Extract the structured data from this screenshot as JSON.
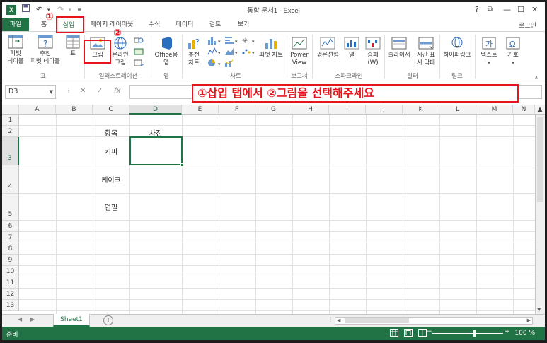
{
  "window": {
    "title": "통합 문서1 - Excel",
    "app_icon": "X",
    "controls": {
      "help": "?",
      "restore": "⧉",
      "minimize": "—",
      "maximize": "☐",
      "close": "✕"
    }
  },
  "tabs": [
    {
      "id": "file",
      "label": "파일"
    },
    {
      "id": "home",
      "label": "홈"
    },
    {
      "id": "insert",
      "label": "삽입"
    },
    {
      "id": "layout",
      "label": "페이지 레이아웃"
    },
    {
      "id": "formulas",
      "label": "수식"
    },
    {
      "id": "data",
      "label": "데이터"
    },
    {
      "id": "review",
      "label": "검토"
    },
    {
      "id": "view",
      "label": "보기"
    }
  ],
  "login": "로그인",
  "ribbon": {
    "buttons": {
      "pivot": "피벗\n테이블",
      "recommended_pivot": "추천\n피벗 테이블",
      "table": "표",
      "picture": "그림",
      "online_picture": "온라인\n그림",
      "office_app": "Office용\n앱",
      "recommended_chart": "추천\n차트",
      "pivot_chart": "피벗 차트",
      "power_view": "Power\nView",
      "line": "꺾은선형",
      "column": "열",
      "win_loss": "승패\n(W)",
      "slicer": "슬라이서",
      "timeline": "시간 표\n시 막대",
      "hyperlink": "하이퍼링크",
      "text": "텍스트",
      "symbol": "기호"
    },
    "groups": {
      "tables": "표",
      "illustrations": "일러스트레이션",
      "apps": "앱",
      "charts": "차트",
      "reports": "보고서",
      "sparklines": "스파크라인",
      "filters": "필터",
      "links": "링크"
    }
  },
  "annotations": {
    "step1": "①",
    "step2": "②",
    "instruction": "①삽입 탭에서 ②그림을 선택해주세요"
  },
  "formula_bar": {
    "name_box": "D3",
    "fx": "fx",
    "cancel": "✕",
    "enter": "✓"
  },
  "grid": {
    "columns": [
      "A",
      "B",
      "C",
      "D",
      "E",
      "F",
      "G",
      "H",
      "I",
      "J",
      "K",
      "L",
      "M",
      "N"
    ],
    "rows": [
      "1",
      "2",
      "3",
      "4",
      "5",
      "6",
      "7",
      "8",
      "9",
      "10",
      "11",
      "12",
      "13"
    ],
    "cells": {
      "C2": "항목",
      "D2": "사진",
      "C3": "커피",
      "C4": "케이크",
      "C5": "연필"
    }
  },
  "sheets": [
    "Sheet1"
  ],
  "status": {
    "text": "준비",
    "zoom": "100 %",
    "zoom_level": 1.0
  },
  "colors": {
    "excel_green": "#217346",
    "highlight_red": "#e8141c"
  }
}
